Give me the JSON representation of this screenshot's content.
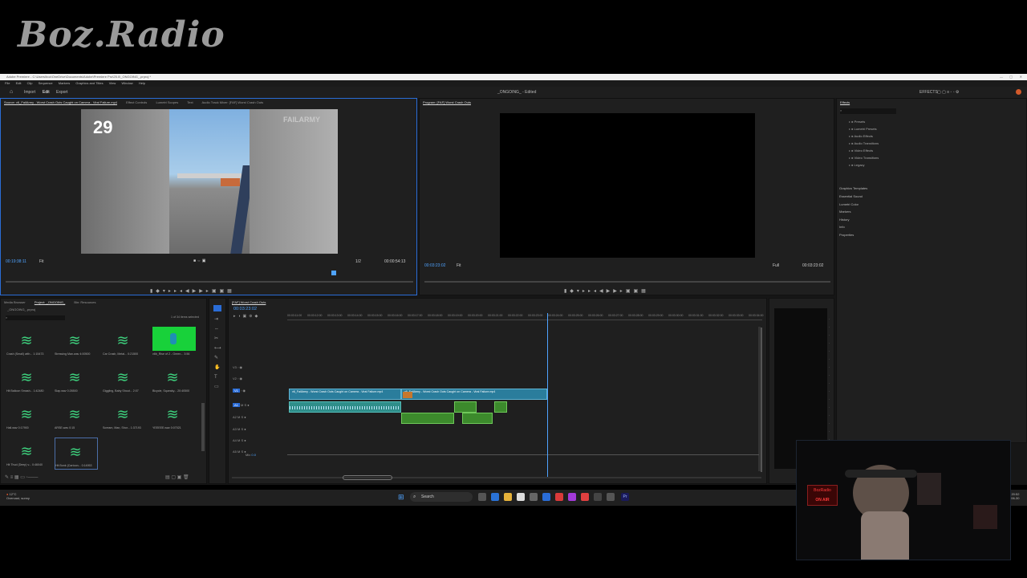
{
  "overlay": {
    "logo": "Boz.Radio",
    "onair_top": "BozRadio",
    "onair_bottom": "ON AIR"
  },
  "window": {
    "title": "Adobe Premiere - C:\\Users\\boz\\OneDrive\\Documents\\Adobe\\Premiere Pro\\25.0\\_ONGOING_.prproj *"
  },
  "menu": [
    "File",
    "Edit",
    "Clip",
    "Sequence",
    "Markers",
    "Graphics and Titles",
    "View",
    "Window",
    "Help"
  ],
  "workspaces": {
    "home": "⌂",
    "import": "Import",
    "edit": "Edit",
    "export": "Export",
    "center_title": "_ONGOING_ - Edited",
    "effects_label": "EFFECTS"
  },
  "source": {
    "tabs": [
      "Source: v6_FailArmy - Worst Crash Outs Caught on Camera - Viral Failure.mp4",
      "Effect Controls",
      "Lumetri Scopes",
      "Text",
      "Audio Track Mixer: [FAF] Worst Crash Outs"
    ],
    "overlay_number": "29",
    "watermark": "FAILARMY",
    "timecode_in": "00:19:38:11",
    "fit": "Fit",
    "quality": "1/2",
    "duration": "00:00:54:13"
  },
  "program": {
    "tab": "Program: [FAF] Worst Crash Outs",
    "timecode": "00:03:23:02",
    "fit": "Fit",
    "quality": "Full",
    "duration": "00:03:23:02"
  },
  "effects": {
    "tab": "Effects",
    "tree": [
      "Presets",
      "Lumetri Presets",
      "Audio Effects",
      "Audio Transitions",
      "Video Effects",
      "Video Transitions",
      "Legacy"
    ],
    "sections": [
      "Graphics Templates",
      "Essential Sound",
      "Lumetri Color",
      "Markers",
      "History",
      "Info",
      "Properties"
    ]
  },
  "project": {
    "tabs": [
      "Media Browser",
      "Project: _ONGOING_",
      "Bin: Resources"
    ],
    "path": "_ONGOING_.prproj",
    "selection": "1 of 34 items selected",
    "items": [
      {
        "label": "Crash (Small) with...",
        "dur": "1:15473",
        "kind": "audio"
      },
      {
        "label": "Stressing Man.wav",
        "dur": "4:00500",
        "kind": "audio"
      },
      {
        "label": "Car Crash, Metal...",
        "dur": "0:21500",
        "kind": "audio"
      },
      {
        "label": "v6b_Rise of Z - Green...",
        "dur": "3:56",
        "kind": "video"
      },
      {
        "label": "Hit Balloon Smash...",
        "dur": "1:42480",
        "kind": "audio"
      },
      {
        "label": "Slap.wav",
        "dur": "0:26500",
        "kind": "audio"
      },
      {
        "label": "Giggling, Baby Shout...",
        "dur": "2:07",
        "kind": "audio"
      },
      {
        "label": "Bicycle, Squeaky...",
        "dur": "20:40500",
        "kind": "audio"
      },
      {
        "label": "Hall.wav",
        "dur": "0:17900",
        "kind": "audio"
      },
      {
        "label": "ARSE.wav",
        "dur": "0:15",
        "kind": "audio"
      },
      {
        "label": "Scream, Man, Shor...",
        "dur": "1:37193",
        "kind": "audio"
      },
      {
        "label": "YEEEEE.wav",
        "dur": "0:07021",
        "kind": "audio"
      },
      {
        "label": "Hit Thud (Deep) v...",
        "dur": "0:46040",
        "kind": "audio"
      },
      {
        "label": "Hit Bonk (Cartoon...",
        "dur": "0:14953",
        "kind": "audio"
      }
    ]
  },
  "timeline": {
    "tab": "[FAF] Worst Crash Outs",
    "timecode": "00:03:23:02",
    "ruler": [
      "00:03:11:00",
      "00:03:12:00",
      "00:03:13:00",
      "00:03:14:00",
      "00:03:15:00",
      "00:03:16:00",
      "00:03:17:00",
      "00:03:18:00",
      "00:03:19:00",
      "00:03:20:00",
      "00:03:21:00",
      "00:03:22:00",
      "00:03:23:00",
      "00:03:24:00",
      "00:03:25:00",
      "00:03:26:00",
      "00:03:27:00",
      "00:03:28:00",
      "00:03:29:00",
      "00:03:30:00",
      "00:03:31:00",
      "00:03:32:00",
      "00:03:33:00",
      "00:03:34:00"
    ],
    "video_tracks": [
      "V3",
      "V2",
      "V1"
    ],
    "audio_tracks": [
      "A1",
      "A2",
      "A3",
      "A4",
      "A5"
    ],
    "mix_label": "Mix",
    "mix_value": "0.0",
    "clip1": "v6_FailArmy - Worst Crash Outs Caught on Camera - Viral Failure.mp4",
    "clip2": "v6_FailArmy - Worst Crash Outs Caught on Camera - Viral Failure.mp4"
  },
  "taskbar": {
    "weather_temp": "12°C",
    "weather_desc": "Overcast, sunny",
    "search": "Search",
    "time": "20:52",
    "date": "2024-06-30"
  }
}
